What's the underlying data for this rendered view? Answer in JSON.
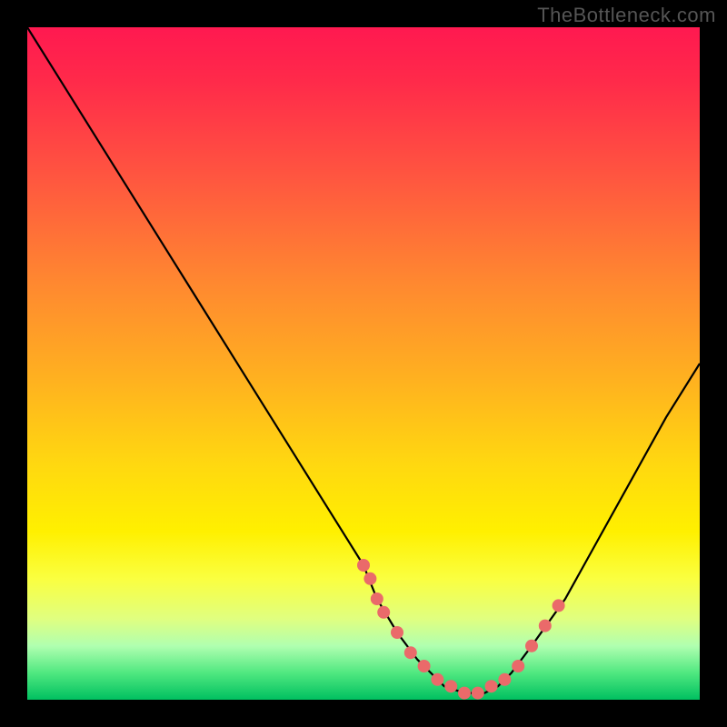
{
  "watermark": "TheBottleneck.com",
  "chart_data": {
    "type": "line",
    "title": "",
    "xlabel": "",
    "ylabel": "",
    "xlim": [
      0,
      100
    ],
    "ylim": [
      0,
      100
    ],
    "grid": false,
    "series": [
      {
        "name": "bottleneck-curve",
        "x": [
          0,
          5,
          10,
          15,
          20,
          25,
          30,
          35,
          40,
          45,
          50,
          52,
          55,
          58,
          60,
          62,
          65,
          68,
          70,
          72,
          75,
          80,
          85,
          90,
          95,
          100
        ],
        "y": [
          100,
          92,
          84,
          76,
          68,
          60,
          52,
          44,
          36,
          28,
          20,
          15,
          10,
          6,
          4,
          2,
          1,
          1,
          2,
          4,
          8,
          15,
          24,
          33,
          42,
          50
        ],
        "color": "#000000"
      }
    ],
    "marker_points": {
      "name": "highlight-markers",
      "x": [
        50,
        51,
        52,
        53,
        55,
        57,
        59,
        61,
        63,
        65,
        67,
        69,
        71,
        73,
        75,
        77,
        79
      ],
      "y": [
        20,
        18,
        15,
        13,
        10,
        7,
        5,
        3,
        2,
        1,
        1,
        2,
        3,
        5,
        8,
        11,
        14
      ],
      "color": "#ea6a6a"
    },
    "background_gradient": {
      "stops": [
        {
          "pos": 0,
          "color": "#ff1950"
        },
        {
          "pos": 0.22,
          "color": "#ff5540"
        },
        {
          "pos": 0.52,
          "color": "#ffb020"
        },
        {
          "pos": 0.75,
          "color": "#fff000"
        },
        {
          "pos": 0.92,
          "color": "#b0ffb0"
        },
        {
          "pos": 1.0,
          "color": "#00c060"
        }
      ]
    }
  }
}
